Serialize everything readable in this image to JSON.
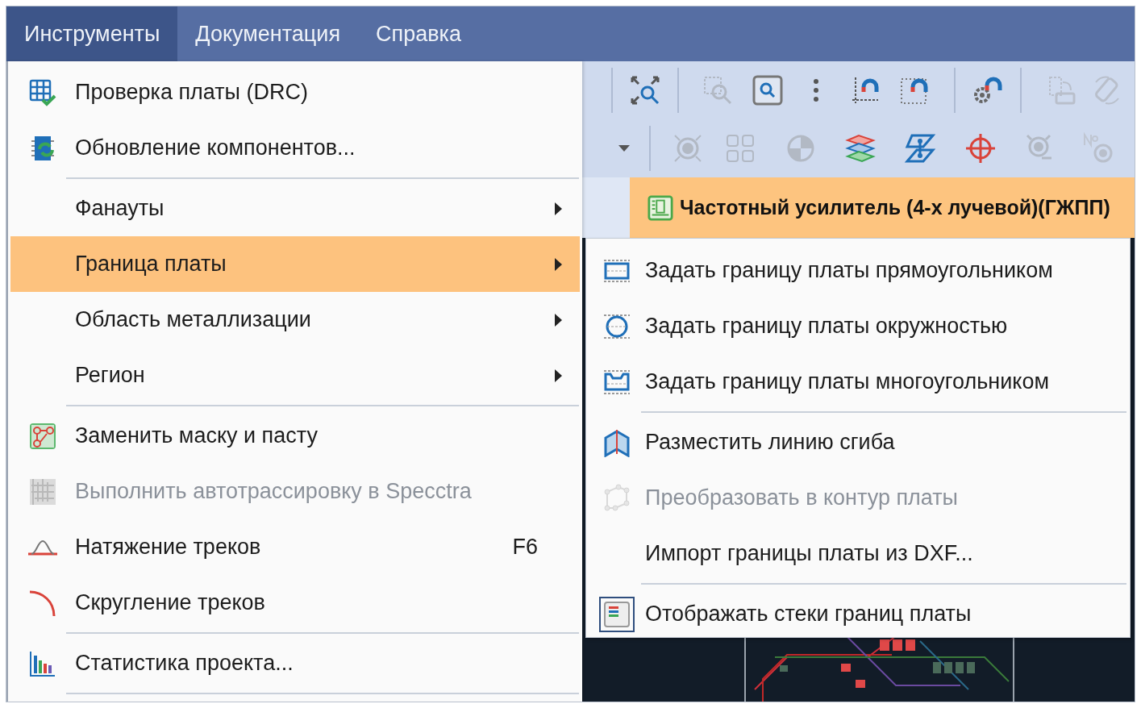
{
  "menubar": [
    {
      "label": "Инструменты",
      "selected": true
    },
    {
      "label": "Документация",
      "selected": false
    },
    {
      "label": "Справка",
      "selected": false
    }
  ],
  "toolbar": [
    {
      "buttons": [
        {
          "disabled": false
        },
        {
          "disabled": true
        },
        {
          "disabled": false
        },
        {
          "disabled": false
        },
        {
          "disabled": false
        },
        {
          "disabled": false
        },
        {
          "disabled": false
        },
        {
          "disabled": true
        },
        {
          "disabled": true
        }
      ]
    },
    {
      "buttons": [
        {
          "disabled": false
        },
        {
          "disabled": true
        },
        {
          "disabled": true
        },
        {
          "disabled": true
        },
        {
          "disabled": false
        },
        {
          "disabled": false
        },
        {
          "disabled": false
        },
        {
          "disabled": true
        },
        {
          "disabled": true
        }
      ]
    }
  ],
  "document_tab": {
    "title": "Частотный усилитель (4-х лучевой)(ГЖПП)",
    "selected": true
  },
  "menu": {
    "items": [
      {
        "label": "Проверка платы (DRC)",
        "selected": false,
        "disabled": false,
        "submenu": false,
        "separator_after": false
      },
      {
        "label": "Обновление компонентов...",
        "selected": false,
        "disabled": false,
        "submenu": false,
        "separator_after": true
      },
      {
        "label": "Фанауты",
        "selected": false,
        "disabled": false,
        "submenu": true,
        "separator_after": false
      },
      {
        "label": "Граница платы",
        "selected": true,
        "disabled": false,
        "submenu": true,
        "separator_after": false
      },
      {
        "label": "Область металлизации",
        "selected": false,
        "disabled": false,
        "submenu": true,
        "separator_after": false
      },
      {
        "label": "Регион",
        "selected": false,
        "disabled": false,
        "submenu": true,
        "separator_after": true
      },
      {
        "label": "Заменить маску и пасту",
        "selected": false,
        "disabled": false,
        "submenu": false,
        "separator_after": false
      },
      {
        "label": "Выполнить автотрассировку в Specctra",
        "selected": false,
        "disabled": true,
        "submenu": false,
        "separator_after": false
      },
      {
        "label": "Натяжение треков",
        "shortcut": "F6",
        "selected": false,
        "disabled": false,
        "submenu": false,
        "separator_after": false
      },
      {
        "label": "Скругление треков",
        "selected": false,
        "disabled": false,
        "submenu": false,
        "separator_after": true
      },
      {
        "label": "Статистика проекта...",
        "selected": false,
        "disabled": false,
        "submenu": false,
        "separator_after": true
      }
    ]
  },
  "submenu": {
    "items": [
      {
        "label": "Задать границу платы прямоугольником",
        "selected": false,
        "disabled": false,
        "checked": false,
        "separator_after": false
      },
      {
        "label": "Задать границу платы окружностью",
        "selected": false,
        "disabled": false,
        "checked": false,
        "separator_after": false
      },
      {
        "label": "Задать границу платы многоугольником",
        "selected": false,
        "disabled": false,
        "checked": false,
        "separator_after": true
      },
      {
        "label": "Разместить линию сгиба",
        "selected": false,
        "disabled": false,
        "checked": false,
        "separator_after": false
      },
      {
        "label": "Преобразовать в контур платы",
        "selected": false,
        "disabled": true,
        "checked": false,
        "separator_after": false
      },
      {
        "label": "Импорт границы платы из DXF...",
        "selected": false,
        "disabled": false,
        "checked": false,
        "separator_after": true
      },
      {
        "label": "Отображать стеки границ платы",
        "selected": false,
        "disabled": false,
        "checked": true,
        "separator_after": false
      }
    ]
  }
}
